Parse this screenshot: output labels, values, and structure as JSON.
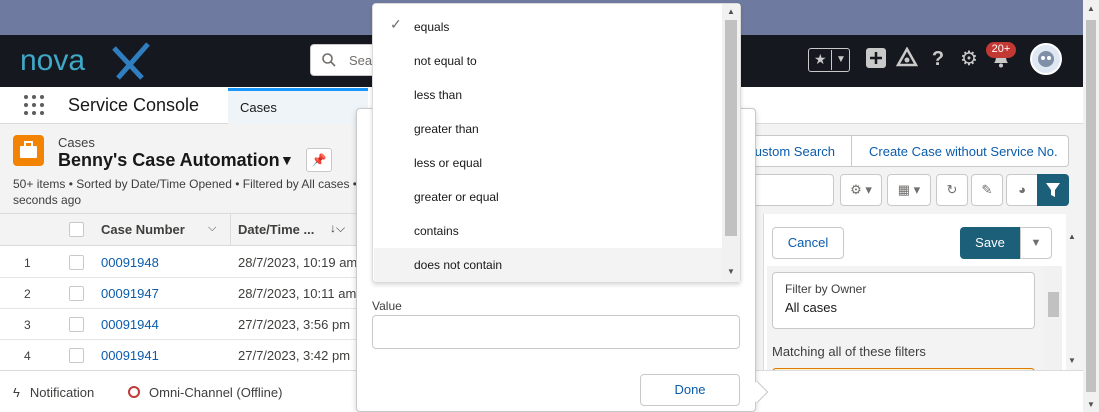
{
  "header": {
    "logo_text": "novaX",
    "search_placeholder": "Search..."
  },
  "notifications": {
    "badge": "20+"
  },
  "nav": {
    "app_name": "Service Console",
    "tab_label": "Cases"
  },
  "list": {
    "object_label": "Cases",
    "title": "Benny's Case Automation",
    "info": "50+ items • Sorted by Date/Time Opened • Filtered by All cases • Updated a few seconds ago",
    "info_visible": "50+ items • Sorted by Date/Time Opened • Filtered by All cases •",
    "info_line2": "seconds ago",
    "buttons": {
      "custom_search": "ustom Search",
      "create_case": "Create Case without Service No."
    }
  },
  "table": {
    "headers": {
      "case_number": "Case Number",
      "date_time": "Date/Time ..."
    },
    "rows": [
      {
        "num": "1",
        "case": "00091948",
        "date": "28/7/2023, 10:19 am"
      },
      {
        "num": "2",
        "case": "00091947",
        "date": "28/7/2023, 10:11 am"
      },
      {
        "num": "3",
        "case": "00091944",
        "date": "27/7/2023, 3:56 pm"
      },
      {
        "num": "4",
        "case": "00091941",
        "date": "27/7/2023, 3:42 pm"
      }
    ]
  },
  "filter_panel": {
    "cancel": "Cancel",
    "save": "Save",
    "owner_label": "Filter by Owner",
    "owner_value": "All cases",
    "matching": "Matching all of these filters"
  },
  "popover": {
    "value_label": "Value",
    "value_input": "",
    "done": "Done"
  },
  "operator_dropdown": {
    "selected": "equals",
    "highlighted": "does not contain",
    "options": [
      "equals",
      "not equal to",
      "less than",
      "greater than",
      "less or equal",
      "greater or equal",
      "contains",
      "does not contain"
    ]
  },
  "utility_bar": {
    "notification": "Notification",
    "omni": "Omni-Channel (Offline)"
  },
  "colors": {
    "header_bg": "#16181f",
    "brand_teal": "#1b5f79",
    "case_orange": "#f38303",
    "link_blue": "#0b5cab",
    "offline_red": "#c23934"
  }
}
